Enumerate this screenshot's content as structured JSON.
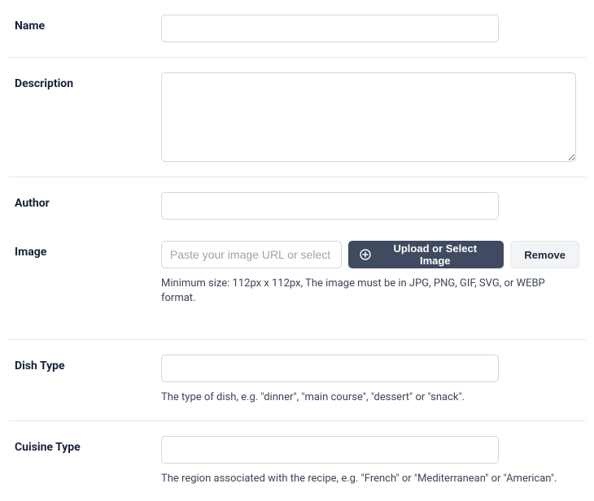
{
  "fields": {
    "name": {
      "label": "Name"
    },
    "description": {
      "label": "Description"
    },
    "author": {
      "label": "Author"
    },
    "image": {
      "label": "Image",
      "placeholder": "Paste your image URL or select a new image",
      "upload_button": "Upload or Select Image",
      "remove_button": "Remove",
      "help": "Minimum size: 112px x 112px, The image must be in JPG, PNG, GIF, SVG, or WEBP format."
    },
    "dish_type": {
      "label": "Dish Type",
      "help": "The type of dish, e.g. \"dinner\", \"main course\", \"dessert\" or \"snack\"."
    },
    "cuisine_type": {
      "label": "Cuisine Type",
      "help": "The region associated with the recipe, e.g. \"French\" or \"Mediterranean\" or \"American\"."
    }
  }
}
